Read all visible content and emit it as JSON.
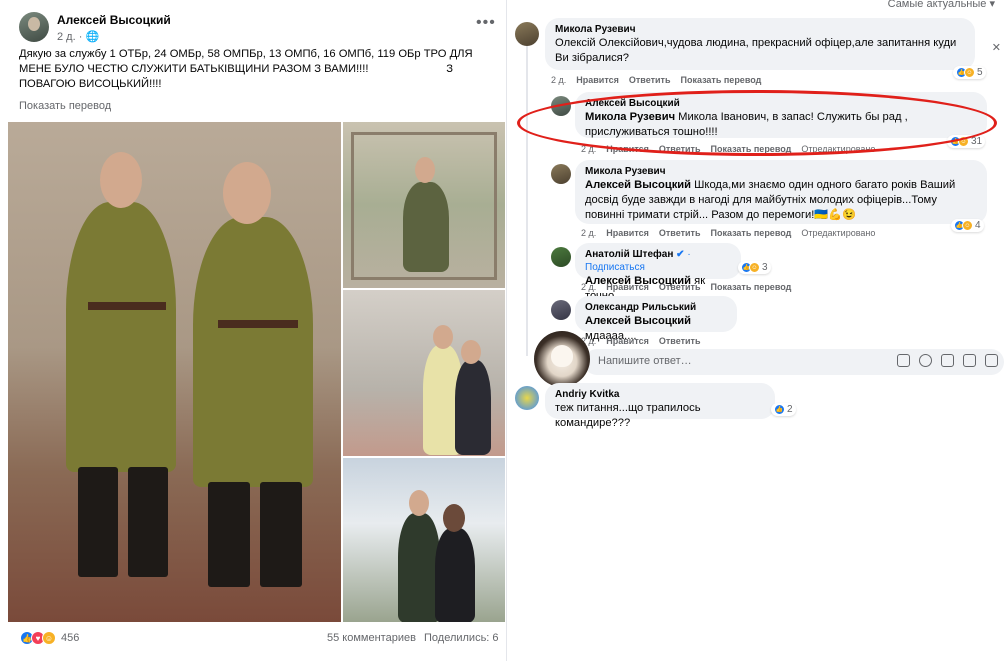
{
  "post": {
    "author": "Алексей Высоцкий",
    "meta": "2 д. · ",
    "globe_icon": "globe-icon",
    "more_label": "•••",
    "text": "Дякую за службу 1 ОТБр, 24 ОМБр, 58 ОМПБр, 13 ОМПб, 16 ОМПб, 119 ОБр ТРО ДЛЯ МЕНЕ БУЛО ЧЕСТЮ СЛУЖИТИ БАТЬКІВЩИНИ РАЗОМ З ВАМИ!!!!                         З ПОВАГОЮ ВИСОЦЬКИЙ!!!!",
    "translate": "Показать перевод",
    "reactions_count": "456",
    "comments_count": "55 комментариев",
    "shares_count": "Поделились: 6"
  },
  "comments_panel": {
    "sort_label": "Самые актуальные ▾",
    "comments": [
      {
        "name": "Микола Рузевич",
        "text": "Олексій Олексійович,чудова людина, прекрасний офіцер,але запитання куди Ви зібралися?",
        "time": "2 д.",
        "like": "Нравится",
        "reply": "Ответить",
        "translate": "Показать перевод",
        "reactions": "5"
      },
      {
        "name": "Алексей Высоцкий",
        "mention": "Микола Рузевич",
        "text": " Микола Іванович, в запас! Служить бы рад , прислуживаться тошно!!!!",
        "time": "2 д.",
        "like": "Нравится",
        "reply": "Ответить",
        "translate": "Показать перевод",
        "edited": "Отредактировано",
        "reactions": "31"
      },
      {
        "name": "Микола Рузевич",
        "mention": "Алексей Высоцкий",
        "text": " Шкода,ми знаємо один одного багато років Ваший досвід буде завжди в нагоді для майбутніх молодих офіцерів...Тому повинні тримати стрій... Разом до перемоги!🇺🇦💪😉",
        "time": "2 д.",
        "like": "Нравится",
        "reply": "Ответить",
        "translate": "Показать перевод",
        "edited": "Отредактировано",
        "reactions": "4"
      },
      {
        "name": "Анатолій Штефан",
        "verified": "✔",
        "subscribe": "· Подписаться",
        "mention": "Алексей Высоцкий",
        "text": " як точно.",
        "time": "2 д.",
        "like": "Нравится",
        "reply": "Ответить",
        "translate": "Показать перевод",
        "reactions": "3"
      },
      {
        "name": "Олександр Рильський",
        "mention": "Алексей Высоцкий",
        "text": " мдаааа....",
        "time": "2 д.",
        "like": "Нравится",
        "reply": "Ответить"
      },
      {
        "name": "Andriy Kvitka",
        "text": "теж питання...що трапилось командире???",
        "reactions": "2"
      }
    ],
    "reply_placeholder": "Напишите ответ…",
    "close_label": "✕"
  },
  "colors": {
    "accent": "#1877f2",
    "highlight_ring": "#e0201a",
    "bubble": "#f0f2f5"
  }
}
